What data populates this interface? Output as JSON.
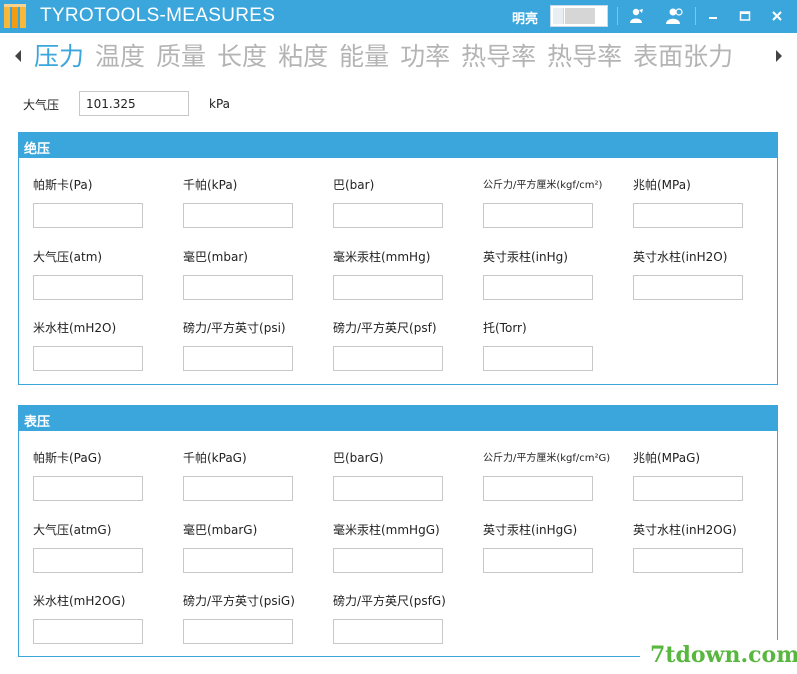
{
  "titlebar": {
    "app_title": "TYROTOOLS-MEASURES",
    "brightness_label": "明亮",
    "brightness_level": 0.75,
    "accent_color": "#3aa6dc",
    "buttons": [
      {
        "name": "skin-icon"
      },
      {
        "name": "user-icon"
      },
      {
        "name": "minimize-icon"
      },
      {
        "name": "maximize-icon"
      },
      {
        "name": "close-icon"
      }
    ]
  },
  "tabs": [
    {
      "label": "压力",
      "active": true
    },
    {
      "label": "温度"
    },
    {
      "label": "质量"
    },
    {
      "label": "长度"
    },
    {
      "label": "粘度"
    },
    {
      "label": "能量"
    },
    {
      "label": "功率"
    },
    {
      "label": "热导率"
    },
    {
      "label": "热导率"
    },
    {
      "label": "表面张力"
    }
  ],
  "pressure_input": {
    "label": "大气压",
    "value": "101.325",
    "unit": "kPa"
  },
  "absolute": {
    "title": "绝压",
    "fields": [
      {
        "label": "帕斯卡(Pa)"
      },
      {
        "label": "千帕(kPa)"
      },
      {
        "label": "巴(bar)"
      },
      {
        "label": "公斤力/平方厘米(kgf/cm²)"
      },
      {
        "label": "兆帕(MPa)"
      },
      {
        "label": "大气压(atm)"
      },
      {
        "label": "毫巴(mbar)"
      },
      {
        "label": "毫米汞柱(mmHg)"
      },
      {
        "label": "英寸汞柱(inHg)"
      },
      {
        "label": "英寸水柱(inH2O)"
      },
      {
        "label": "米水柱(mH2O)"
      },
      {
        "label": "磅力/平方英寸(psi)"
      },
      {
        "label": "磅力/平方英尺(psf)"
      },
      {
        "label": "托(Torr)"
      }
    ]
  },
  "gauge": {
    "title": "表压",
    "fields": [
      {
        "label": "帕斯卡(PaG)"
      },
      {
        "label": "千帕(kPaG)"
      },
      {
        "label": "巴(barG)"
      },
      {
        "label": "公斤力/平方厘米(kgf/cm²G)"
      },
      {
        "label": "兆帕(MPaG)"
      },
      {
        "label": "大气压(atmG)"
      },
      {
        "label": "毫巴(mbarG)"
      },
      {
        "label": "毫米汞柱(mmHgG)"
      },
      {
        "label": "英寸汞柱(inHgG)"
      },
      {
        "label": "英寸水柱(inH2OG)"
      },
      {
        "label": "米水柱(mH2OG)"
      },
      {
        "label": "磅力/平方英寸(psiG)"
      },
      {
        "label": "磅力/平方英尺(psfG)"
      }
    ]
  },
  "watermark": "7tdown.com"
}
